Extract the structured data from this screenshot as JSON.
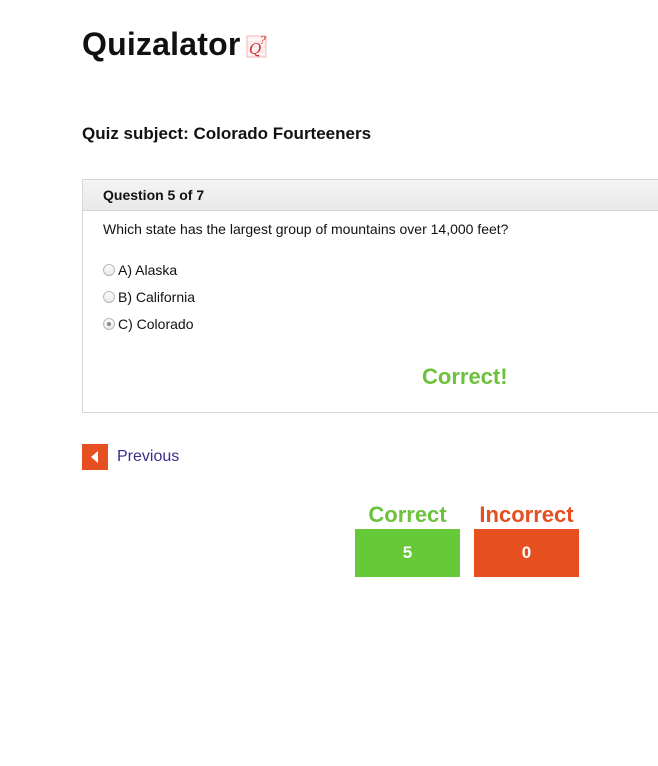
{
  "app": {
    "title": "Quizalator",
    "logo_icon": "quiz-q-question-icon"
  },
  "quiz": {
    "subject": "Quiz subject: Colorado Fourteeners"
  },
  "question": {
    "header": "Question 5 of 7",
    "text": "Which state has the largest group of mountains over 14,000 feet?",
    "options": [
      {
        "label": "A) Alaska",
        "selected": false
      },
      {
        "label": "B) California",
        "selected": false
      },
      {
        "label": "C) Colorado",
        "selected": true
      }
    ],
    "result": "Correct!"
  },
  "navigation": {
    "previous_label": "Previous",
    "previous_icon": "chevron-left-icon"
  },
  "score": {
    "correct_label": "Correct",
    "correct_value": "5",
    "incorrect_label": "Incorrect",
    "incorrect_value": "0"
  },
  "colors": {
    "correct": "#6cc23a",
    "incorrect": "#e64f1f",
    "link": "#3f2a8c"
  }
}
